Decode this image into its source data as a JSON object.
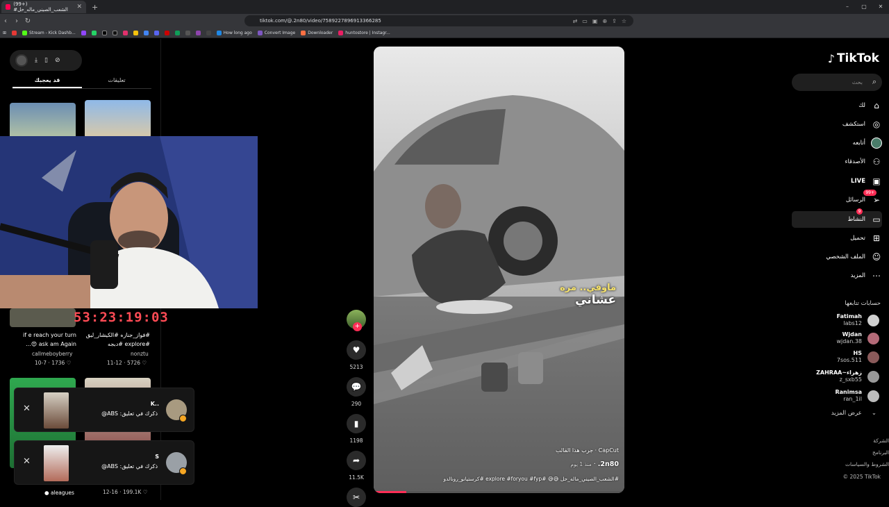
{
  "browser": {
    "tab_title": "(99+) #الشعب_الصيني_ماله_حل",
    "tab_close": "✕",
    "new_tab": "+",
    "url": "tiktok.com/@.2n80/video/7589227896913366285",
    "bookmarks": [
      "Stream - Kick Dashb...",
      "How long ago",
      "Convert Image",
      "Downloader",
      "huntostore | Instagr..."
    ]
  },
  "left_panel": {
    "tabs": [
      "تعليقات",
      "قد يعجبك"
    ],
    "active_tab": "قد يعجبك",
    "timer": "53:23:19:03",
    "items": [
      {
        "caption_line1": "if e reach your turn",
        "caption_line2": "ask am Again 😍...",
        "author": "callmeboyberry",
        "date": "10-7",
        "likes": "1736"
      },
      {
        "caption_line1": "#فواز_جنازه #الكيشار_ليق",
        "caption_line2": "#explore #دبجه",
        "author": "nonztu",
        "date": "11-12",
        "likes": "5726"
      },
      {
        "author": "aleagues",
        "date": "12-16",
        "likes": "199.1K"
      }
    ]
  },
  "notifications": [
    {
      "name": "K..",
      "text": "ذكرك في تعليق: ABS@"
    },
    {
      "name": "S",
      "text": "ذكرك في تعليق: ABS@"
    }
  ],
  "video": {
    "overlay_line1": "ماوفي.. مره",
    "overlay_line2": "عشاني",
    "capcut": "CapCut · جرب هذا القالب",
    "author": "2n80.",
    "posted": "منذ 1 يوم",
    "caption": "#الشعب_الصيني_ماله_حل 😅😅 #explore #foryou #fyp #كرستيانو_رونالدو",
    "progress": 0.13
  },
  "actions": {
    "likes": "5213",
    "comments": "290",
    "saves": "1198",
    "shares": "11.5K"
  },
  "right_nav": {
    "logo": "TikTok",
    "search_placeholder": "بحث",
    "items": [
      {
        "label": "لك",
        "icon": "home-icon"
      },
      {
        "label": "استكشف",
        "icon": "compass-icon"
      },
      {
        "label": "أتابعه",
        "icon": "following-icon"
      },
      {
        "label": "الأصدقاء",
        "icon": "friends-icon"
      },
      {
        "label": "LIVE",
        "icon": "live-icon"
      },
      {
        "label": "الرسائل",
        "icon": "messages-icon"
      },
      {
        "label": "النشاط",
        "icon": "activity-icon"
      },
      {
        "label": "تحميل",
        "icon": "upload-icon"
      },
      {
        "label": "الملف الشخصي",
        "icon": "profile-icon"
      },
      {
        "label": "المزيد",
        "icon": "more-icon"
      }
    ],
    "messages_badge": "99+",
    "activity_badge": "9",
    "following_title": "حسابات تتابعها",
    "following": [
      {
        "name": "Fatimah",
        "handle": "labs12"
      },
      {
        "name": "Wjdan",
        "handle": "wjdan.38"
      },
      {
        "name": "HS",
        "handle": "7sos.511"
      },
      {
        "name": "ZAHRAA~زهراء",
        "handle": "z_sxb55"
      },
      {
        "name": "Ranimsa",
        "handle": "ran_1il"
      }
    ],
    "see_more": "عرض المزيد",
    "footer": [
      "الشركة",
      "البرنامج",
      "الشروط والسياسات",
      "© 2025 TikTok"
    ]
  }
}
